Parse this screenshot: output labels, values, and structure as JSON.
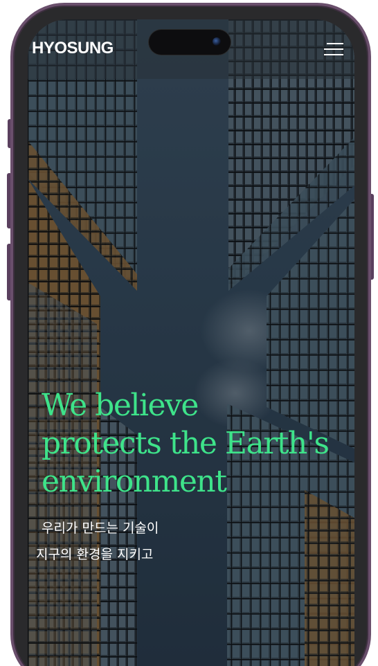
{
  "header": {
    "logo_text": "HYOSUNG",
    "menu_icon": "hamburger-menu-icon"
  },
  "hero": {
    "title_lines": [
      "We believe",
      "protects the Earth's",
      "environment"
    ],
    "subtitle_lines": [
      "우리가 만드는 기술이",
      "지구의 환경을 지키고"
    ]
  },
  "colors": {
    "accent": "#3ee38a",
    "frame": "#6a4f6c",
    "sky": "#2d3f50",
    "text": "#ffffff"
  }
}
